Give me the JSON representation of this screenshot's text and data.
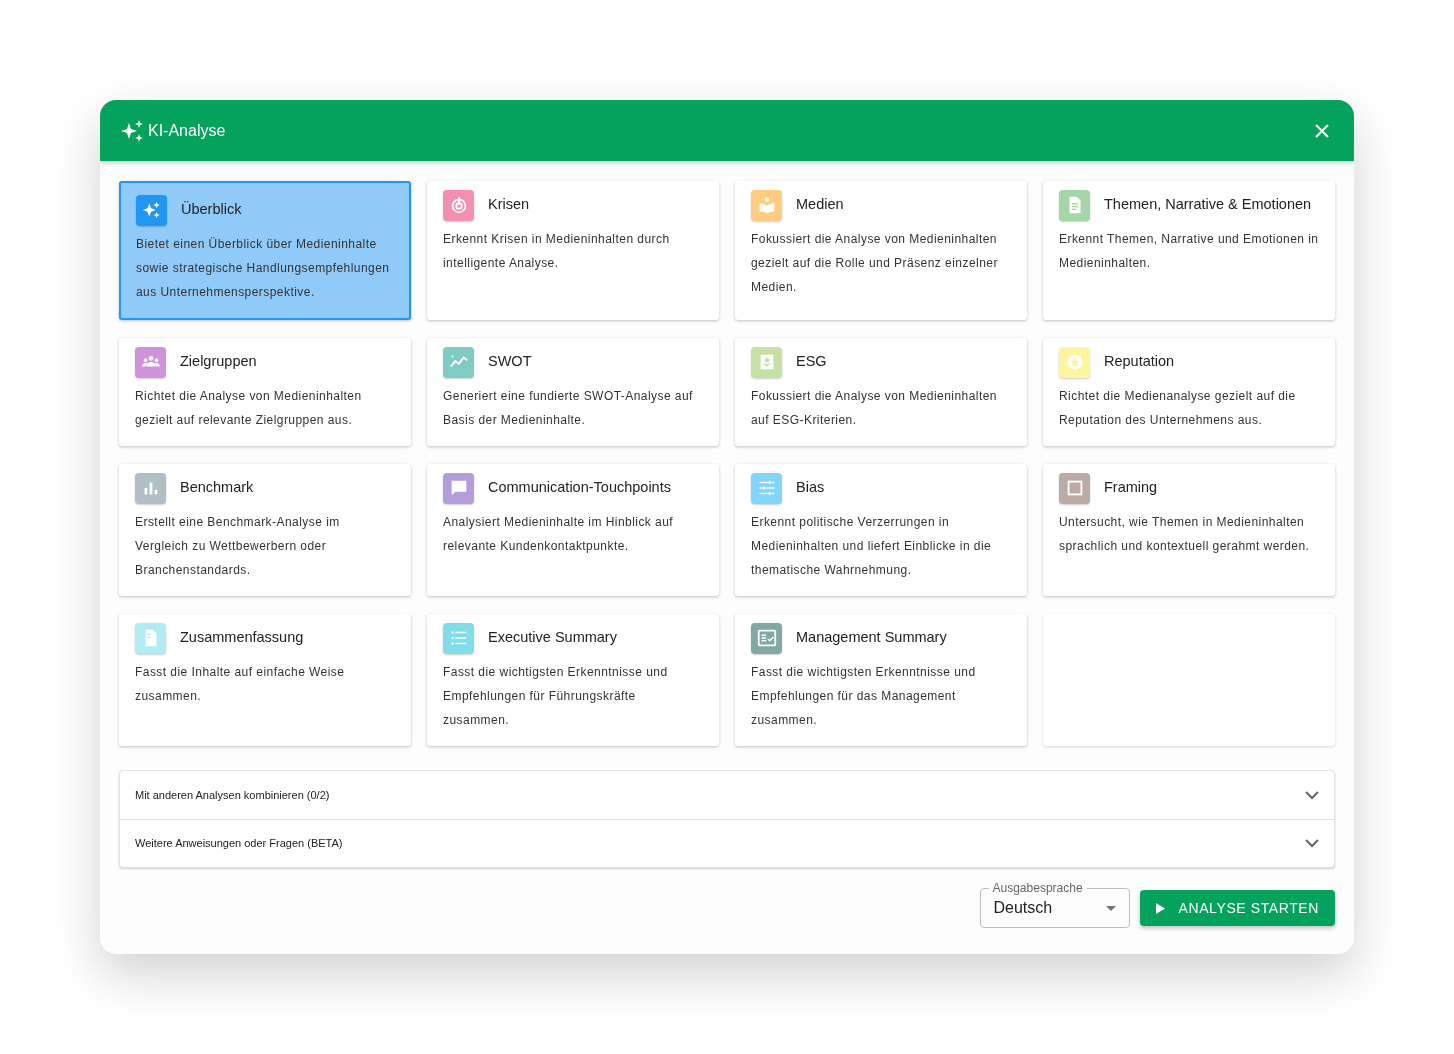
{
  "dialog": {
    "title": "KI-Analyse"
  },
  "analyses": [
    {
      "title": "Überblick",
      "description": "Bietet einen Überblick über Medieninhalte sowie strategische Handlungsempfehlungen aus Unternehmensperspektive.",
      "color": "#2196f3",
      "selected": true
    },
    {
      "title": "Krisen",
      "description": "Erkennt Krisen in Medieninhalten durch intelligente Analyse.",
      "color": "#f48fb1",
      "selected": false
    },
    {
      "title": "Medien",
      "description": "Fokussiert die Analyse von Medieninhalten gezielt auf die Rolle und Präsenz einzelner Medien.",
      "color": "#ffcc80",
      "selected": false
    },
    {
      "title": "Themen, Narrative & Emotionen",
      "description": "Erkennt Themen, Narrative und Emotionen in Medieninhalten.",
      "color": "#a5d6a7",
      "selected": false
    },
    {
      "title": "Zielgruppen",
      "description": "Richtet die Analyse von Medieninhalten gezielt auf relevante Zielgruppen aus.",
      "color": "#ce93d8",
      "selected": false
    },
    {
      "title": "SWOT",
      "description": "Generiert eine fundierte SWOT-Analyse auf Basis der Medieninhalte.",
      "color": "#80cbc4",
      "selected": false
    },
    {
      "title": "ESG",
      "description": "Fokussiert die Analyse von Medieninhalten auf ESG-Kriterien.",
      "color": "#c5e1a5",
      "selected": false
    },
    {
      "title": "Reputation",
      "description": "Richtet die Medienanalyse gezielt auf die Reputation des Unternehmens aus.",
      "color": "#fff59d",
      "selected": false
    },
    {
      "title": "Benchmark",
      "description": "Erstellt eine Benchmark-Analyse im Vergleich zu Wettbewerbern oder Branchenstandards.",
      "color": "#b0bec5",
      "selected": false
    },
    {
      "title": "Communication-Touchpoints",
      "description": "Analysiert Medieninhalte im Hinblick auf relevante Kundenkontaktpunkte.",
      "color": "#b39ddb",
      "selected": false
    },
    {
      "title": "Bias",
      "description": "Erkennt politische Verzerrungen in Medieninhalten und liefert Einblicke in die thematische Wahrnehmung.",
      "color": "#81d4fa",
      "selected": false
    },
    {
      "title": "Framing",
      "description": "Untersucht, wie Themen in Medieninhalten sprachlich und kontextuell gerahmt werden.",
      "color": "#bcaaa4",
      "selected": false
    },
    {
      "title": "Zusammenfassung",
      "description": "Fasst die Inhalte auf einfache Weise zusammen.",
      "color": "#b2ebf2",
      "selected": false
    },
    {
      "title": "Executive Summary",
      "description": "Fasst die wichtigsten Erkenntnisse und Empfehlungen für Führungskräfte zusammen.",
      "color": "#80deea",
      "selected": false
    },
    {
      "title": "Management Summary",
      "description": "Fasst die wichtigsten Erkenntnisse und Empfehlungen für das Management zusammen.",
      "color": "#80a9a5",
      "selected": false
    }
  ],
  "accordions": [
    {
      "label": "Mit anderen Analysen kombinieren (0/2)",
      "expanded": false
    },
    {
      "label": "Weitere Anweisungen oder Fragen (BETA)",
      "expanded": false
    }
  ],
  "language_select": {
    "label": "Ausgabesprache",
    "value": "Deutsch"
  },
  "start_button": {
    "label": "ANALYSE STARTEN"
  }
}
